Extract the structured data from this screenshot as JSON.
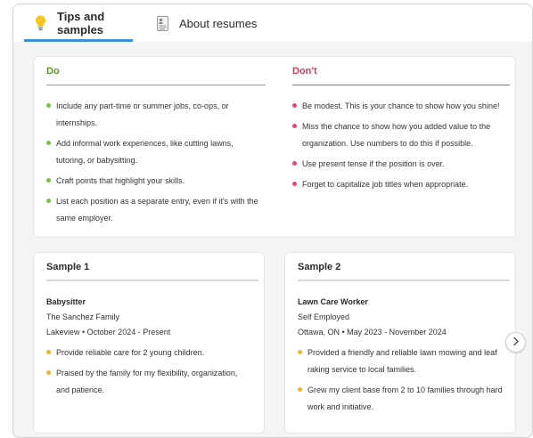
{
  "tabs": [
    {
      "label": "Tips and samples",
      "icon": "lightbulb-icon",
      "active": true
    },
    {
      "label": "About resumes",
      "icon": "document-icon",
      "active": false
    }
  ],
  "do": {
    "heading": "Do",
    "color": "#5a9a1e",
    "items": [
      "Include any part-time or summer jobs, co-ops, or internships.",
      "Add informal work experiences, like cutting lawns, tutoring, or babysitting.",
      "Craft points that highlight your skills.",
      "List each position as a separate entry, even if it's with the same employer."
    ]
  },
  "dont": {
    "heading": "Don't",
    "color": "#d93a5b",
    "items": [
      "Be modest. This is your chance to show how you shine!",
      "Miss the chance to show how you added value to the organization. Use numbers to do this if possible.",
      "Use present tense if the position is over.",
      "Forget to capitalize job titles when appropriate."
    ]
  },
  "samples": [
    {
      "title": "Sample 1",
      "job": "Babysitter",
      "employer": "The Sanchez Family",
      "location_dates": "Lakeview • October 2024 - Present",
      "points": [
        "Provide reliable care for 2 young children.",
        "Praised by the family for my flexibility, organization, and patience."
      ]
    },
    {
      "title": "Sample 2",
      "job": "Lawn Care Worker",
      "employer": "Self Employed",
      "location_dates": "Ottawa, ON • May 2023 - November 2024",
      "points": [
        "Provided a friendly and reliable lawn mowing and leaf raking service to local families.",
        "Grew my client base from 2 to 10 families through hard work and initiative."
      ]
    }
  ],
  "colors": {
    "tab_accent": "#3b8fd9",
    "sample_bullet": "#f2b233"
  },
  "next_button_icon": "chevron-right-icon"
}
